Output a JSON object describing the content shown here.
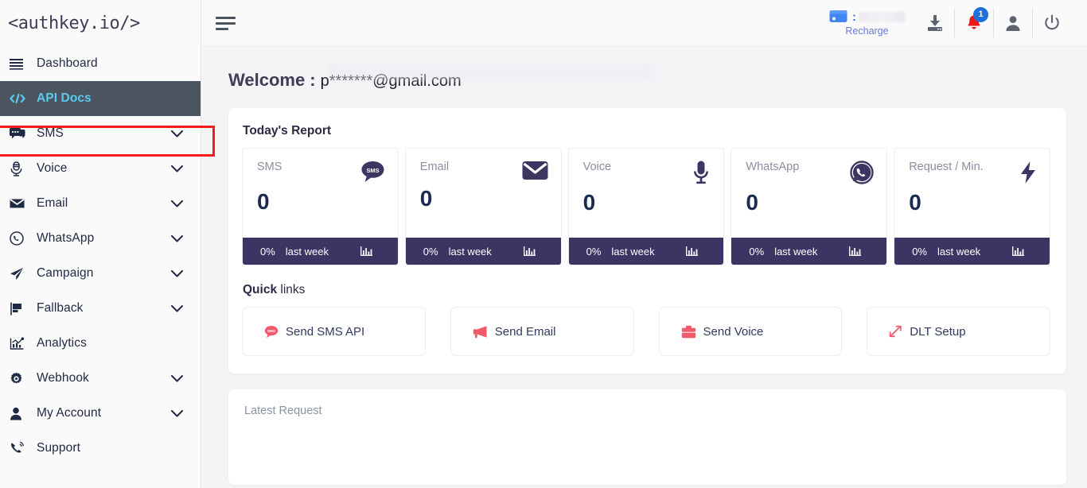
{
  "brand": {
    "logo_text": "<authkey.io/>"
  },
  "sidebar": {
    "items": [
      {
        "label": "Dashboard",
        "icon": "menu-bars-icon",
        "expandable": false,
        "active": false
      },
      {
        "label": "API Docs",
        "icon": "code-tags-icon",
        "expandable": false,
        "active": true
      },
      {
        "label": "SMS",
        "icon": "chat-bubble-icon",
        "expandable": true,
        "active": false
      },
      {
        "label": "Voice",
        "icon": "microphone-icon",
        "expandable": true,
        "active": false
      },
      {
        "label": "Email",
        "icon": "envelope-icon",
        "expandable": true,
        "active": false
      },
      {
        "label": "WhatsApp",
        "icon": "whatsapp-icon",
        "expandable": true,
        "active": false
      },
      {
        "label": "Campaign",
        "icon": "paper-plane-icon",
        "expandable": true,
        "active": false
      },
      {
        "label": "Fallback",
        "icon": "fallback-flag-icon",
        "expandable": true,
        "active": false
      },
      {
        "label": "Analytics",
        "icon": "bar-chart-icon",
        "expandable": false,
        "active": false
      },
      {
        "label": "Webhook",
        "icon": "gear-icon",
        "expandable": true,
        "active": false
      },
      {
        "label": "My Account",
        "icon": "user-icon",
        "expandable": true,
        "active": false
      },
      {
        "label": "Support",
        "icon": "phone-icon",
        "expandable": false,
        "active": false
      }
    ]
  },
  "topbar": {
    "menu_toggle": "hamburger-icon",
    "wallet": {
      "separator": ":",
      "balance": "",
      "recharge_label": "Recharge"
    },
    "download_label": "download-icon",
    "notifications": {
      "count": "1"
    },
    "profile_label": "user-icon",
    "logout_label": "power-icon"
  },
  "main": {
    "welcome_label": "Welcome :",
    "welcome_email": "p*******@gmail.com",
    "todays_report_title": "Today's Report",
    "quick_links_title_bold": "Quick",
    "quick_links_title_light": " links",
    "latest_request_title": "Latest Request"
  },
  "stats": [
    {
      "name": "SMS",
      "value": "0",
      "percent": "0%",
      "period": "last week",
      "icon": "sms-bubble-icon"
    },
    {
      "name": "Email",
      "value": "0",
      "percent": "0%",
      "period": "last week",
      "icon": "envelope-icon"
    },
    {
      "name": "Voice",
      "value": "0",
      "percent": "0%",
      "period": "last week",
      "icon": "microphone-icon"
    },
    {
      "name": "WhatsApp",
      "value": "0",
      "percent": "0%",
      "period": "last week",
      "icon": "whatsapp-icon"
    },
    {
      "name": "Request / Min.",
      "value": "0",
      "percent": "0%",
      "period": "last week",
      "icon": "bolt-icon"
    }
  ],
  "quick_links": [
    {
      "label": "Send SMS API",
      "icon": "sms-bubble-icon"
    },
    {
      "label": "Send Email",
      "icon": "megaphone-icon"
    },
    {
      "label": "Send Voice",
      "icon": "briefcase-icon"
    },
    {
      "label": "DLT Setup",
      "icon": "arrows-expand-icon"
    }
  ],
  "colors": {
    "accent_blue": "#5cc8ee",
    "active_nav_bg": "#4a555f",
    "card_footer": "#3c3563",
    "highlight_red": "#f81919",
    "quick_link_icon": "#f05a6a",
    "badge_blue": "#1e6fd9"
  }
}
